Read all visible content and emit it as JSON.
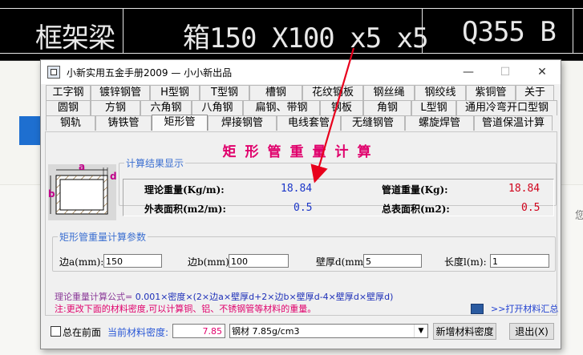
{
  "background": {
    "cad_texts": [
      "框架梁",
      "箱150 X100 x5 x5",
      "Q355 B"
    ],
    "right_text": "您"
  },
  "window": {
    "title": "小新实用五金手册2009 — 小小新出品",
    "controls": {
      "minimize": "—",
      "maximize": "☐",
      "close": "✕"
    }
  },
  "tabs": {
    "row1": [
      "工字钢",
      "镀锌钢管",
      "H型钢",
      "T型钢",
      "槽钢",
      "花纹钢板",
      "钢丝绳",
      "钢绞线",
      "紫铜管",
      "关于"
    ],
    "row2": [
      "圆钢",
      "方钢",
      "六角钢",
      "八角钢",
      "扁钢、带钢",
      "钢板",
      "角钢",
      "L型钢",
      "通用冷弯开口型钢"
    ],
    "row3": [
      "钢轨",
      "铸铁管",
      "矩形管",
      "焊接钢管",
      "电线套管",
      "无缝钢管",
      "螺旋焊管",
      "管道保温计算"
    ],
    "active": "矩形管"
  },
  "main": {
    "heading": "矩形管重量计算",
    "diagram_labels": {
      "a": "a",
      "b": "b",
      "d": "d"
    },
    "results": {
      "legend": "计算结果显示",
      "theory_label": "理论重量(Kg/m):",
      "theory_value": "18.84",
      "pipe_label": "管道重量(Kg):",
      "pipe_value": "18.84",
      "surface_label": "外表面积(m2/m):",
      "surface_value": "0.5",
      "total_label": "总表面积(m2):",
      "total_value": "0.5"
    },
    "calc": {
      "legend": "矩形管重量计算参数",
      "side_a_label": "边a(mm):",
      "side_a_value": "150",
      "side_b_label": "边b(mm):",
      "side_b_value": "100",
      "wall_label": "壁厚d(mm):",
      "wall_value": "5",
      "length_label": "长度l(m):",
      "length_value": "1"
    },
    "formula_label": "理论重量计算公式=",
    "formula_body": "0.001×密度×(2×边a×壁厚d+2×边b×壁厚d-4×壁厚d×壁厚d)",
    "note": "注:更改下面的材料密度,可以计算铜、铝、不锈钢管等材料的重量。",
    "open_link": ">>打开材料汇总"
  },
  "bottom": {
    "always_on_top": "总在前面",
    "current_density_label": "当前材料密度:",
    "density_value": "7.85",
    "material_selected": "钢材  7.85g/cm3",
    "add_density_button": "新增材料密度",
    "exit_button": "退出(X)"
  },
  "colors": {
    "heading": "#e0006c",
    "value_blue": "#1a35c8",
    "value_red": "#d0021b",
    "legend_blue": "#3b6fd1",
    "annotation_arrow": "#e8001c"
  }
}
